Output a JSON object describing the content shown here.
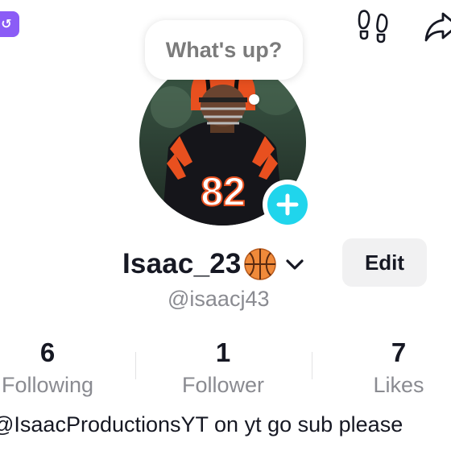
{
  "header": {
    "corner_badge_icon": "app-badge-icon",
    "footprints_icon": "footprints-icon",
    "share_icon": "share-icon"
  },
  "bubble": {
    "text": "What's up?"
  },
  "profile": {
    "avatar": "football-player-photo",
    "jersey_number": "82",
    "add_icon": "plus-icon",
    "username": "Isaac_23",
    "username_emoji": "basketball-icon",
    "dropdown_icon": "chevron-down-icon",
    "handle": "@isaacj43",
    "edit_label": "Edit"
  },
  "stats": [
    {
      "value": "6",
      "label": "Following"
    },
    {
      "value": "1",
      "label": "Follower"
    },
    {
      "value": "7",
      "label": "Likes"
    }
  ],
  "bio": "@IsaacProductionsYT on yt go sub please",
  "colors": {
    "accent": "#20d5ec",
    "badge": "#8b5cf6",
    "text_primary": "#161823",
    "text_secondary": "#8a8b91",
    "button_bg": "#f1f1f2"
  }
}
